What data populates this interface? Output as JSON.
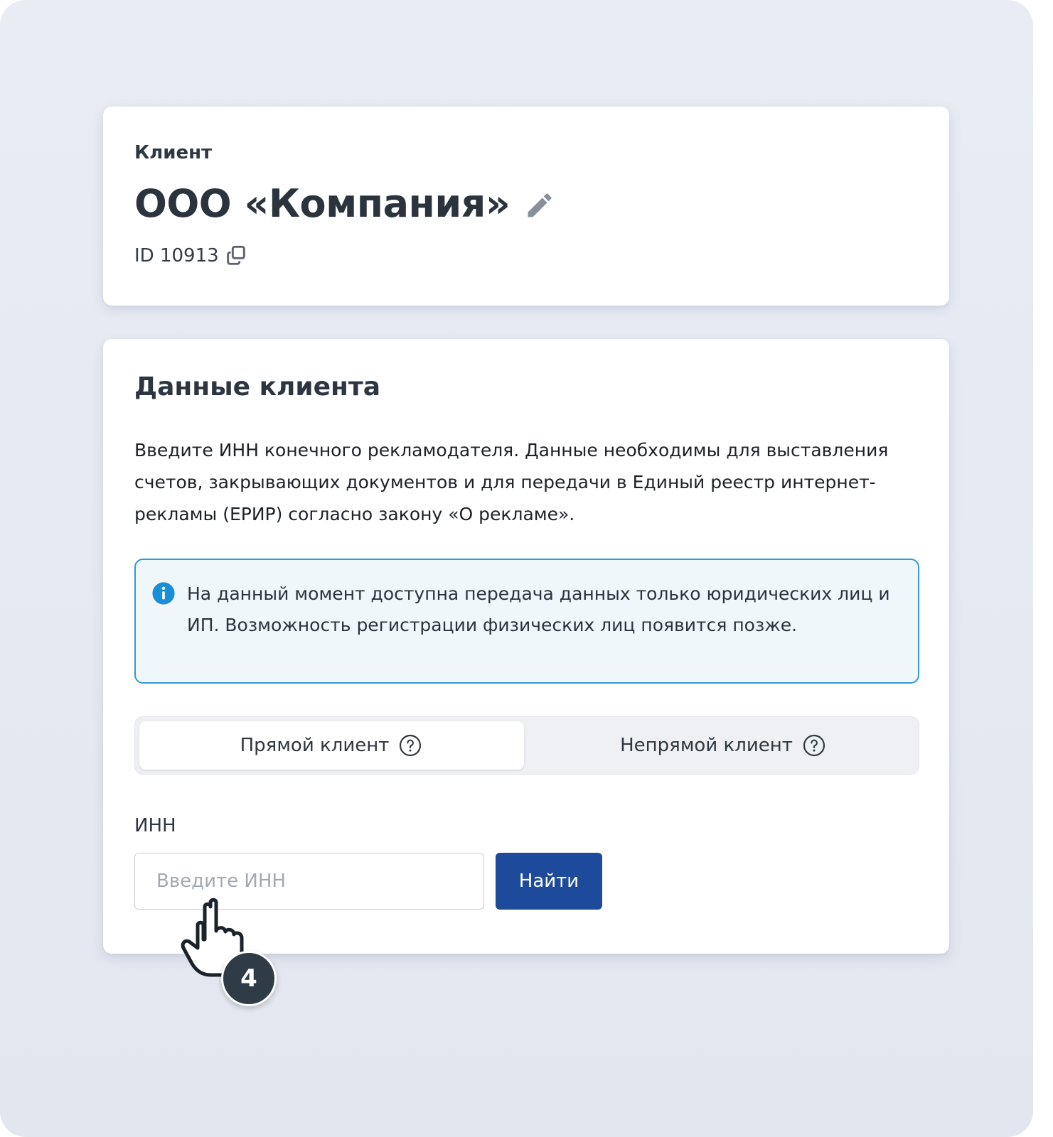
{
  "client_card": {
    "caption": "Клиент",
    "name": "ООО «Компания»",
    "id_text": "ID 10913",
    "edit_icon": "pencil-icon",
    "copy_icon": "copy-icon"
  },
  "client_data": {
    "title": "Данные клиента",
    "description": "Введите ИНН конечного рекламодателя. Данные необходимы для выставления счетов, закрывающих документов и для передачи в Единый реестр интернет-рекламы (ЕРИР) согласно закону «О рекламе».",
    "info": {
      "icon": "info-icon",
      "text": "На данный момент доступна передача данных только юридических лиц и ИП. Возможность регистрации физических лиц появится позже."
    },
    "client_type": {
      "options": [
        {
          "label": "Прямой клиент",
          "active": true
        },
        {
          "label": "Непрямой клиент",
          "active": false
        }
      ]
    },
    "inn": {
      "label": "ИНН",
      "placeholder": "Введите ИНН",
      "value": ""
    },
    "find_button": "Найти"
  },
  "step_badge": "4",
  "colors": {
    "accent": "#1d4a9b",
    "info_border": "#2e9bd6",
    "info_background": "#f0f7fb",
    "info_icon": "#1a8fd6",
    "badge": "#2f3b46"
  }
}
